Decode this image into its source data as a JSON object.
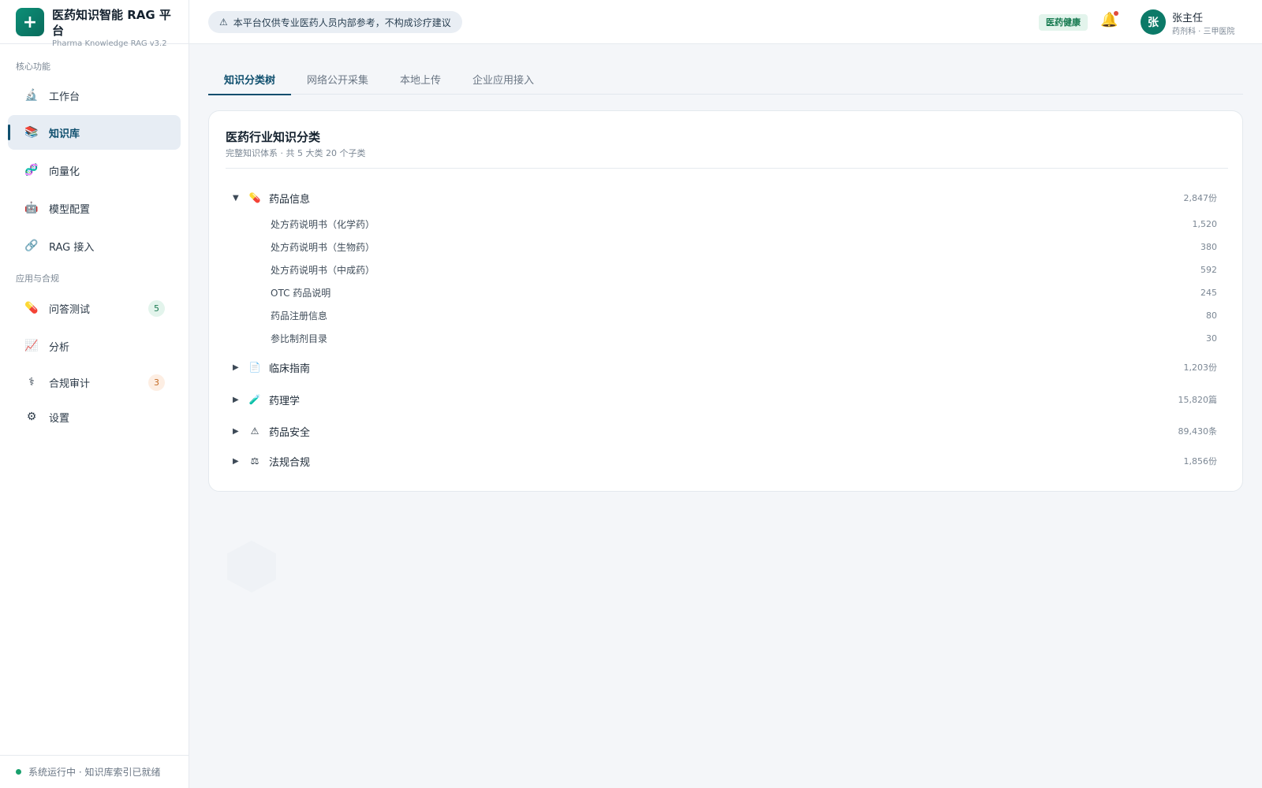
{
  "brand": {
    "logo_glyph": "+",
    "title": "医药知识智能 RAG 平台",
    "subtitle": "Pharma Knowledge RAG v3.2"
  },
  "sidebar": {
    "section_core": "核心功能",
    "section_apps": "应用与合规",
    "items": [
      {
        "label": "工作台",
        "icon": "microscope-icon",
        "glyph": "🔬"
      },
      {
        "label": "知识库",
        "icon": "books-icon",
        "glyph": "📚",
        "active": true
      },
      {
        "label": "向量化",
        "icon": "dna-icon",
        "glyph": "🧬"
      },
      {
        "label": "模型配置",
        "icon": "robot-icon",
        "glyph": "🤖"
      },
      {
        "label": "RAG 接入",
        "icon": "link-icon",
        "glyph": "🔗"
      },
      {
        "label": "问答测试",
        "icon": "pill-icon",
        "glyph": "💊",
        "badge": "5",
        "badge_color": "#1c7a52"
      },
      {
        "label": "分析",
        "icon": "chart-icon",
        "glyph": "📈"
      },
      {
        "label": "合规审计",
        "icon": "caduceus-icon",
        "glyph": "⚕",
        "badge": "3",
        "badge_color": "#c46b25"
      },
      {
        "label": "设置",
        "icon": "gear-icon",
        "glyph": "⚙"
      }
    ],
    "footer_status": "系统运行中 · 知识库索引已就绪"
  },
  "header": {
    "notice_icon": "⚠",
    "notice": "本平台仅供专业医药人员内部参考，不构成诊疗建议",
    "tag": "医药健康",
    "bell_glyph": "🔔",
    "user": {
      "avatar": "张",
      "name": "张主任",
      "dept": "药剂科 · 三甲医院"
    }
  },
  "tabs": [
    "知识分类树",
    "网络公开采集",
    "本地上传",
    "企业应用接入"
  ],
  "card": {
    "title": "医药行业知识分类",
    "subtitle": "完整知识体系 · 共 5 大类 20 个子类",
    "categories": [
      {
        "label": "药品信息",
        "icon": "pill-icon",
        "glyph": "💊",
        "count": "2,847份",
        "expanded": true,
        "children": [
          {
            "label": "处方药说明书（化学药）",
            "count": "1,520"
          },
          {
            "label": "处方药说明书（生物药）",
            "count": "380"
          },
          {
            "label": "处方药说明书（中成药）",
            "count": "592"
          },
          {
            "label": "OTC 药品说明",
            "count": "245"
          },
          {
            "label": "药品注册信息",
            "count": "80"
          },
          {
            "label": "参比制剂目录",
            "count": "30"
          }
        ]
      },
      {
        "label": "临床指南",
        "icon": "document-icon",
        "glyph": "📄",
        "count": "1,203份",
        "expanded": false
      },
      {
        "label": "药理学",
        "icon": "test-tube-icon",
        "glyph": "🧪",
        "count": "15,820篇",
        "expanded": false
      },
      {
        "label": "药品安全",
        "icon": "warning-icon",
        "glyph": "⚠",
        "count": "89,430条",
        "expanded": false
      },
      {
        "label": "法规合规",
        "icon": "scales-icon",
        "glyph": "⚖",
        "count": "1,856份",
        "expanded": false
      }
    ],
    "caret_expanded": "▼",
    "caret_collapsed": "▶"
  },
  "colors": {
    "brand": "#0c8f77",
    "active": "#0f4f6e",
    "accent_green": "#15794f",
    "bell": "#d99a1e"
  }
}
